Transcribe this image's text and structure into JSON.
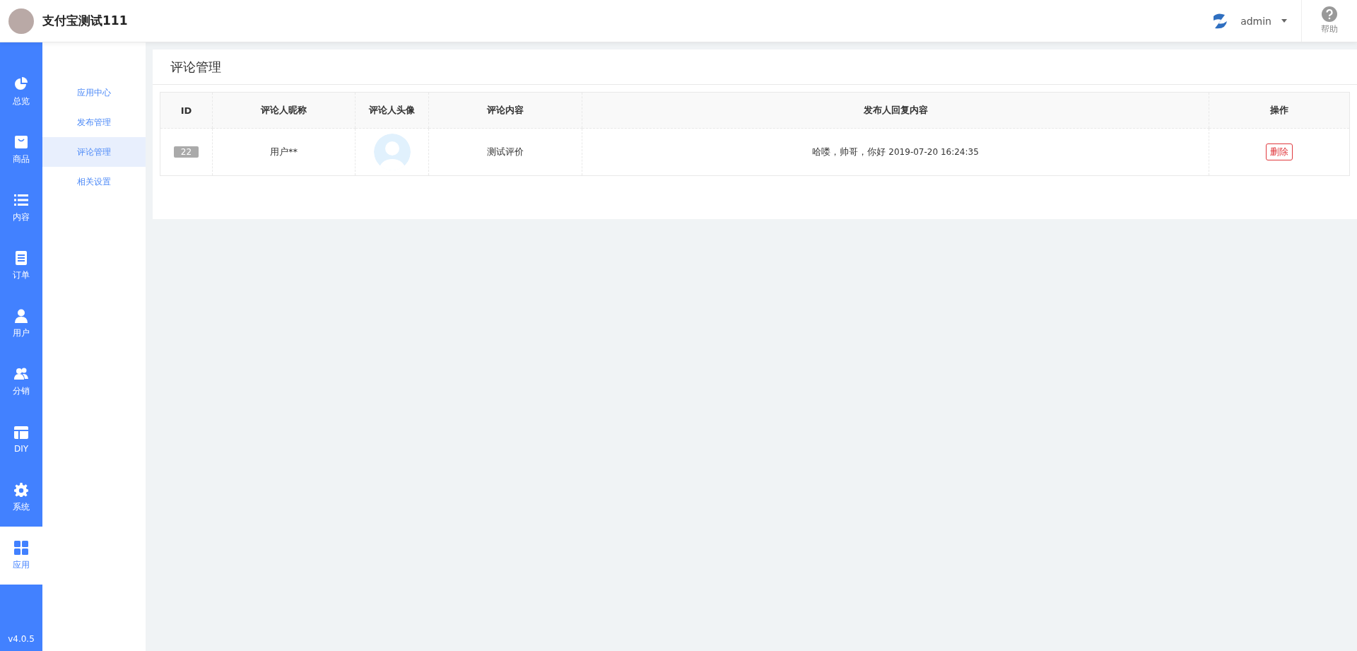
{
  "header": {
    "shop_name": "支付宝测试111",
    "user": "admin",
    "help": "帮助"
  },
  "main_nav": {
    "items": [
      {
        "label": "总览",
        "selected": false
      },
      {
        "label": "商品",
        "selected": false
      },
      {
        "label": "内容",
        "selected": false
      },
      {
        "label": "订单",
        "selected": false
      },
      {
        "label": "用户",
        "selected": false
      },
      {
        "label": "分销",
        "selected": false
      },
      {
        "label": "DIY",
        "selected": false
      },
      {
        "label": "系统",
        "selected": false
      },
      {
        "label": "应用",
        "selected": true
      }
    ],
    "version": "v4.0.5"
  },
  "sub_nav": {
    "items": [
      {
        "label": "应用中心",
        "selected": false
      },
      {
        "label": "发布管理",
        "selected": false
      },
      {
        "label": "评论管理",
        "selected": true
      },
      {
        "label": "相关设置",
        "selected": false
      }
    ]
  },
  "page_title": "评论管理",
  "table": {
    "columns": [
      "ID",
      "评论人昵称",
      "评论人头像",
      "评论内容",
      "发布人回复内容",
      "操作"
    ],
    "rows": [
      {
        "id": "22",
        "nickname": "用户**",
        "content": "测试评价",
        "reply": "哈喽，帅哥，你好",
        "reply_time": "2019-07-20 16:24:35",
        "action": "删除"
      }
    ]
  }
}
